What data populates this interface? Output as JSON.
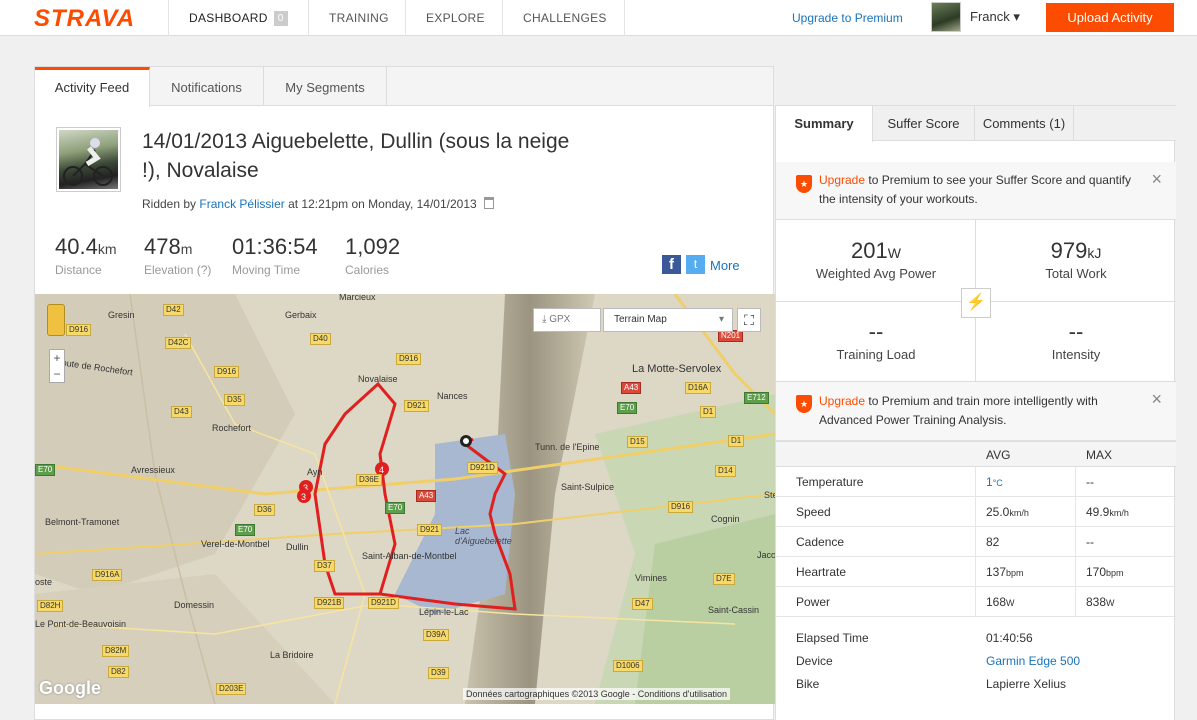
{
  "nav": {
    "logo": "STRAVA",
    "items": [
      {
        "label": "DASHBOARD",
        "badge": "0"
      },
      {
        "label": "TRAINING"
      },
      {
        "label": "EXPLORE"
      },
      {
        "label": "CHALLENGES"
      }
    ],
    "upgrade_link": "Upgrade to Premium",
    "user_name": "Franck ▾",
    "upload_button": "Upload Activity",
    "accent_color": "#fc4c02"
  },
  "feed_tabs": [
    "Activity Feed",
    "Notifications",
    "My Segments"
  ],
  "activity": {
    "title": "14/01/2013 Aiguebelette, Dullin (sous la neige !), Novalaise",
    "ridden_prefix": "Ridden by",
    "athlete": "Franck Pélissier",
    "ridden_suffix": "at 12:21pm on Monday, 14/01/2013",
    "stats": [
      {
        "value": "40.4",
        "unit": "km",
        "label": "Distance"
      },
      {
        "value": "478",
        "unit": "m",
        "label": "Elevation (?)"
      },
      {
        "value": "01:36:54",
        "unit": "",
        "label": "Moving Time"
      },
      {
        "value": "1,092",
        "unit": "",
        "label": "Calories"
      }
    ],
    "share_more": "More"
  },
  "map": {
    "gpx_label": "GPX",
    "map_type": "Terrain Map",
    "copyright": "Données cartographiques ©2013 Google - Conditions d'utilisation",
    "google": "Google",
    "route_color": "#e01f1f",
    "places": [
      "Marcieux",
      "Gresin",
      "Gerbaix",
      "Novalaise",
      "Nances",
      "La Motte-Servolex",
      "Rochefort",
      "Avressieux",
      "Ayn",
      "Tunn. de l'Epine",
      "Saint-Sulpice",
      "Belmont-Tramonet",
      "Verel-de-Montbel",
      "Dullin",
      "Saint-Alban-de-Montbel",
      "Lac d'Aiguebelette",
      "Cognin",
      "Vimines",
      "Domessin",
      "Lépin-le-Lac",
      "Saint-Cassin",
      "Le Pont-de-Beauvoisin",
      "La Bridoire",
      "Route de Rochefort",
      "Jaco",
      "Ste",
      "oste"
    ],
    "roads": [
      "D916",
      "D42",
      "D42C",
      "D40",
      "D916",
      "D916",
      "D35",
      "D43",
      "D36",
      "D921",
      "D36E",
      "D921D",
      "A43",
      "E70",
      "D921",
      "D37",
      "D921B",
      "D921D",
      "D39A",
      "D39",
      "D916A",
      "D82H",
      "D82M",
      "D82",
      "D203E",
      "D15",
      "D16A",
      "D1",
      "D1",
      "D14",
      "D916",
      "D7E",
      "D47",
      "D1006",
      "N201",
      "E712",
      "A43",
      "E70",
      "E70",
      "E70"
    ]
  },
  "summary": {
    "tabs": [
      "Summary",
      "Suffer Score",
      "Comments (1)"
    ],
    "promo1": {
      "link": "Upgrade",
      "text": "to Premium to see your Suffer Score and quantify the intensity of your workouts."
    },
    "power": {
      "value": "201",
      "unit": "W",
      "label": "Weighted Avg Power"
    },
    "work": {
      "value": "979",
      "unit": "kJ",
      "label": "Total Work"
    },
    "training_load": {
      "value": "--",
      "label": "Training Load"
    },
    "intensity": {
      "value": "--",
      "label": "Intensity"
    },
    "promo2": {
      "link": "Upgrade",
      "text": "to Premium and train more intelligently with Advanced Power Training Analysis."
    },
    "table_headers": [
      "AVG",
      "MAX"
    ],
    "rows": [
      {
        "label": "Temperature",
        "avg": "1",
        "avg_unit": "°C",
        "max": "--",
        "max_unit": ""
      },
      {
        "label": "Speed",
        "avg": "25.0",
        "avg_unit": "km/h",
        "max": "49.9",
        "max_unit": "km/h"
      },
      {
        "label": "Cadence",
        "avg": "82",
        "avg_unit": "",
        "max": "--",
        "max_unit": ""
      },
      {
        "label": "Heartrate",
        "avg": "137",
        "avg_unit": "bpm",
        "max": "170",
        "max_unit": "bpm"
      },
      {
        "label": "Power",
        "avg": "168",
        "avg_unit": "W",
        "max": "838",
        "max_unit": "W"
      }
    ],
    "details": [
      {
        "label": "Elapsed Time",
        "value": "01:40:56"
      },
      {
        "label": "Device",
        "value": "Garmin Edge 500"
      },
      {
        "label": "Bike",
        "value": "Lapierre Xelius"
      }
    ]
  }
}
